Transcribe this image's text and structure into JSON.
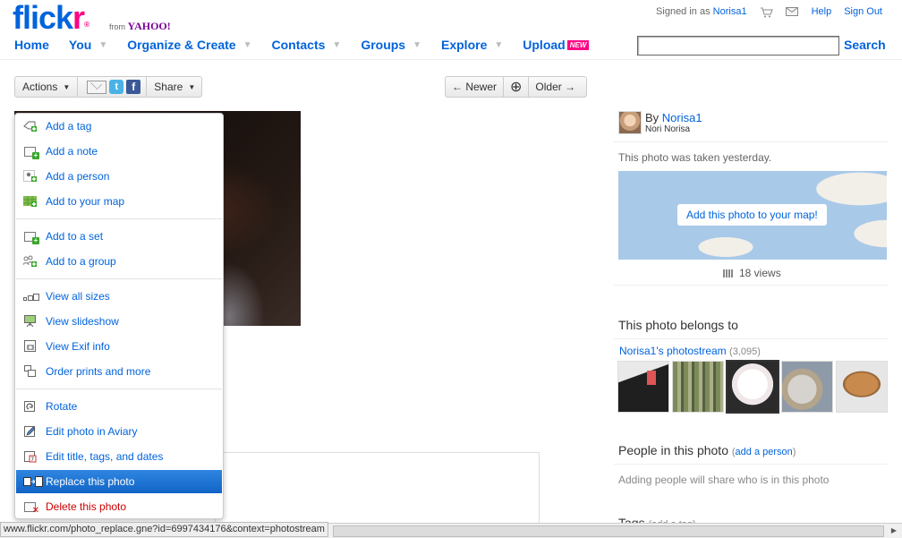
{
  "logo": {
    "text_a": "flick",
    "text_b": "r",
    "reg": "®",
    "from": "from",
    "yahoo": "YAHOO!"
  },
  "userbar": {
    "signed_in_prefix": "Signed in as",
    "username": "Norisa1",
    "help": "Help",
    "sign_out": "Sign Out"
  },
  "nav": {
    "home": "Home",
    "you": "You",
    "organize": "Organize & Create",
    "contacts": "Contacts",
    "groups": "Groups",
    "explore": "Explore",
    "upload": "Upload",
    "new_badge": "NEW"
  },
  "search": {
    "value": "",
    "button": "Search"
  },
  "toolbar": {
    "actions": "Actions",
    "share": "Share",
    "newer": "← Newer",
    "older": "Older →",
    "zoom_icon": "⊕"
  },
  "menu": {
    "items": [
      {
        "label": "Add a tag"
      },
      {
        "label": "Add a note"
      },
      {
        "label": "Add a person"
      },
      {
        "label": "Add to your map"
      },
      {
        "label": "Add to a set"
      },
      {
        "label": "Add to a group"
      },
      {
        "label": "View all sizes"
      },
      {
        "label": "View slideshow"
      },
      {
        "label": "View Exif info"
      },
      {
        "label": "Order prints and more"
      },
      {
        "label": "Rotate"
      },
      {
        "label": "Edit photo in Aviary"
      },
      {
        "label": "Edit title, tags, and dates"
      },
      {
        "label": "Replace this photo"
      },
      {
        "label": "Delete this photo"
      }
    ],
    "selected_index": 13
  },
  "owner": {
    "by": "By",
    "username": "Norisa1",
    "realname": "Nori Norisa"
  },
  "photo_info": {
    "taken": "This photo was taken yesterday.",
    "map_button": "Add this photo to your map!",
    "views": "18 views"
  },
  "belongs": {
    "title": "This photo belongs to",
    "stream": "Norisa1's photostream",
    "count": "(3,095)"
  },
  "people": {
    "title": "People in this photo",
    "open": "(",
    "add": "add a person",
    "close": ")",
    "text": "Adding people will share who is in this photo"
  },
  "tags": {
    "title": "Tags",
    "add": "(add a tag)"
  },
  "status_url": "www.flickr.com/photo_replace.gne?id=6997434176&context=photostream",
  "colors": {
    "link": "#0063dc",
    "pink": "#ff0084",
    "selected": "#1164c7"
  }
}
